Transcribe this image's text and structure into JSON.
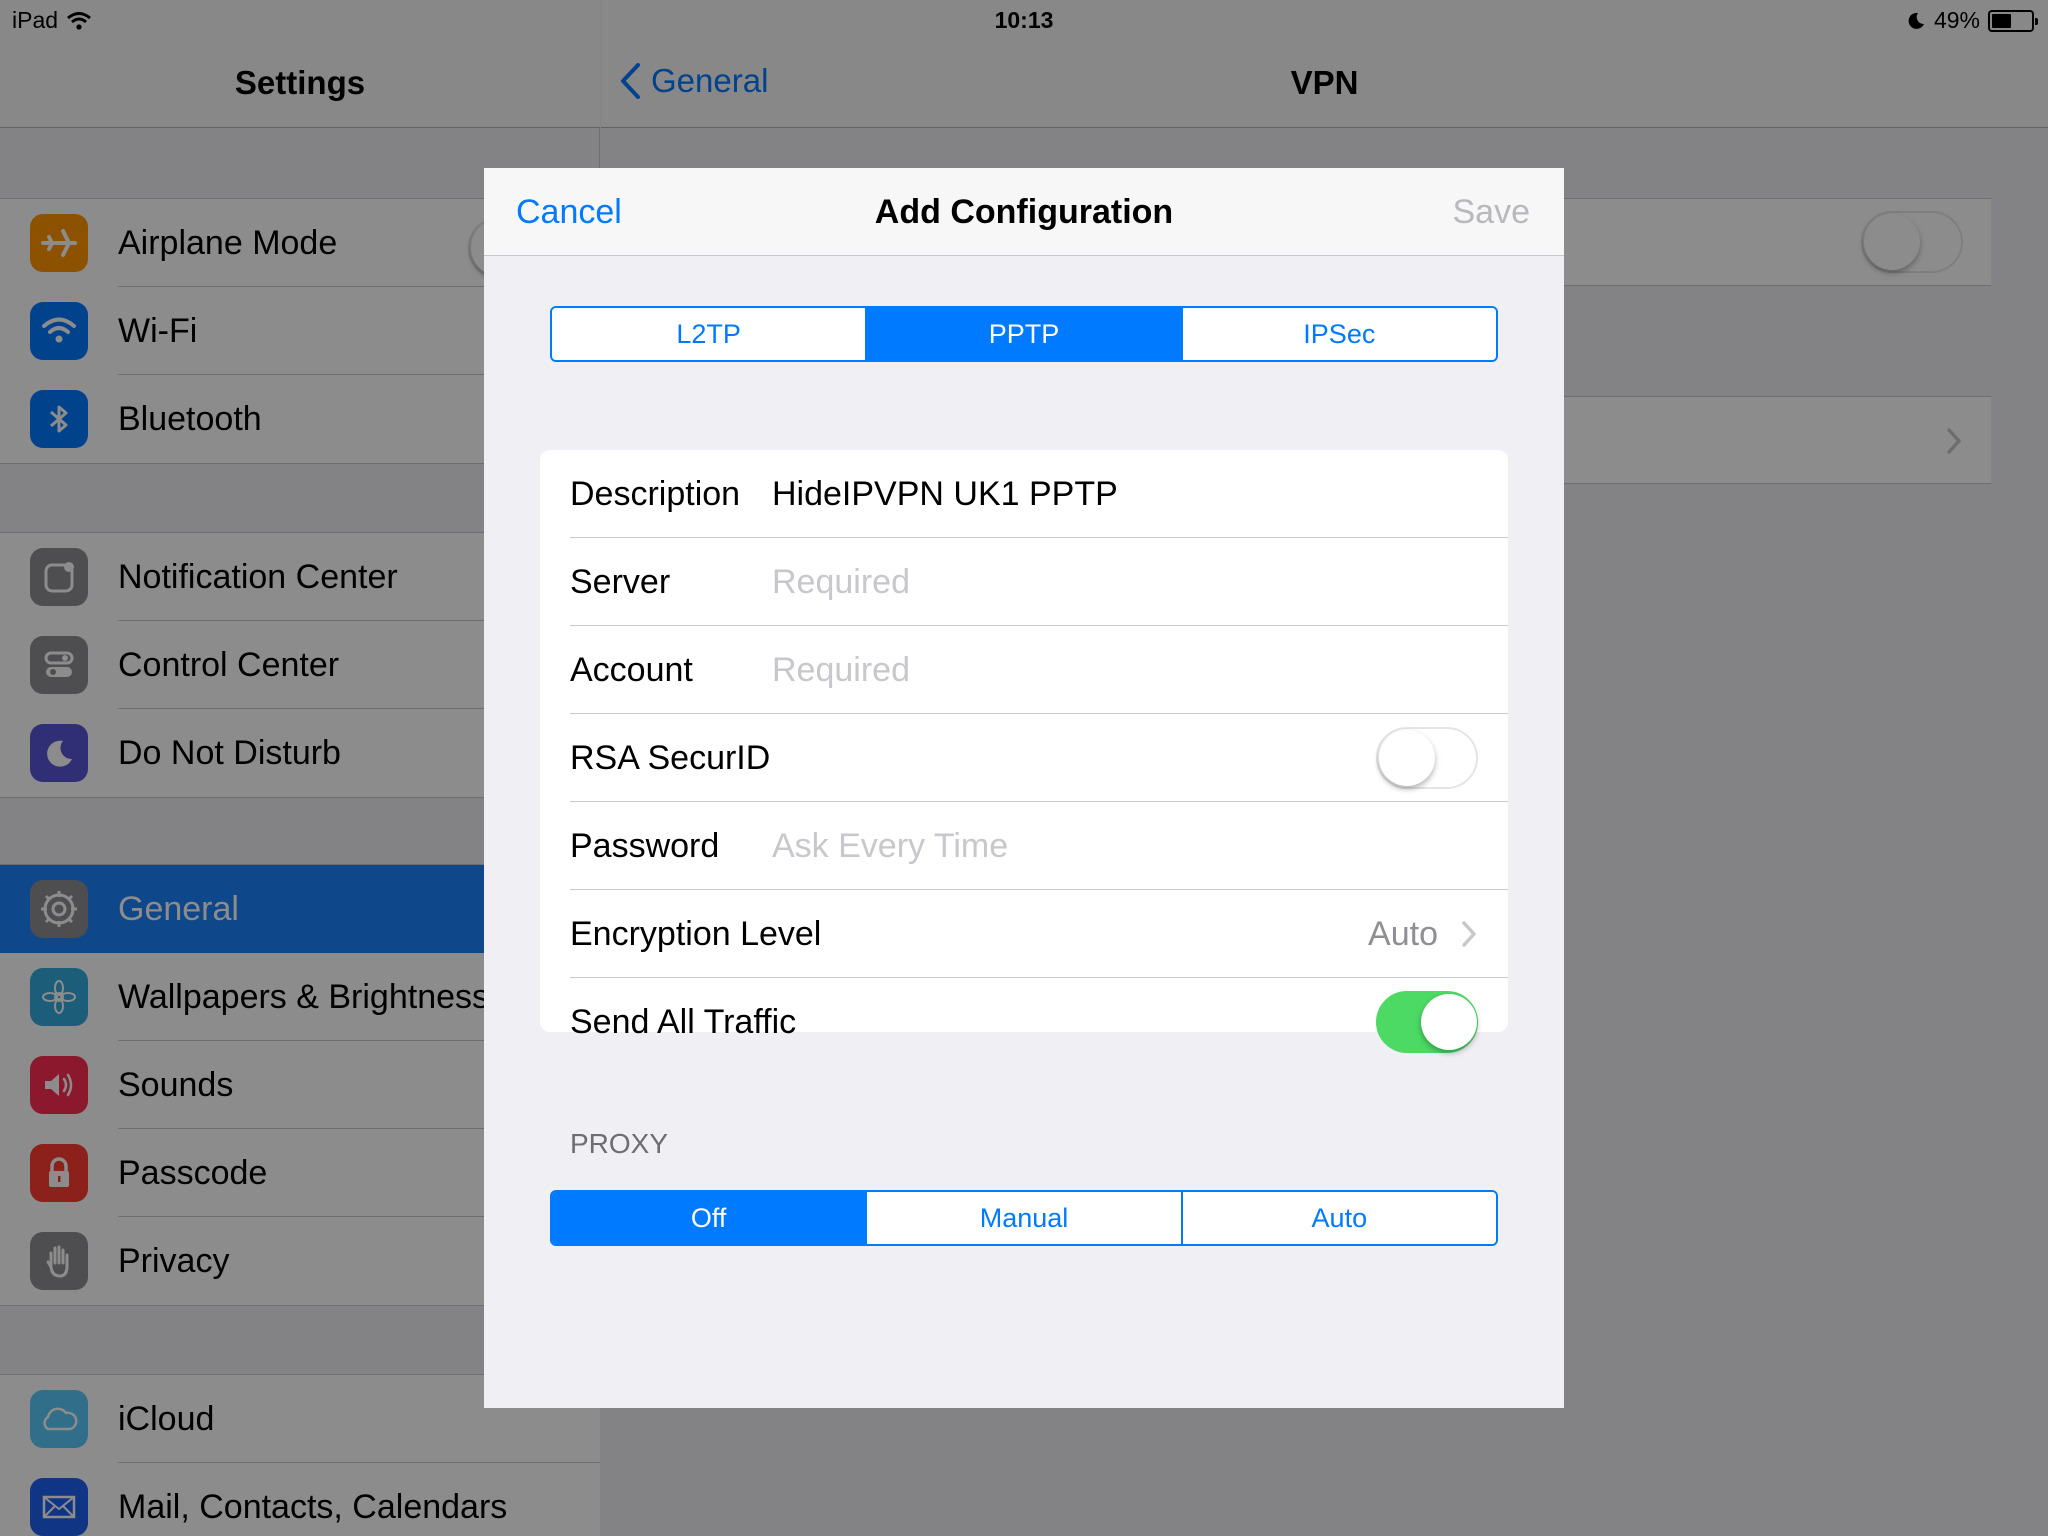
{
  "status_bar": {
    "device": "iPad",
    "time": "10:13",
    "battery": "49%",
    "battery_level": 0.49
  },
  "master": {
    "title": "Settings",
    "groups": [
      [
        {
          "label": "Airplane Mode",
          "icon": "airplane-icon",
          "color": "#ff9500"
        },
        {
          "label": "Wi-Fi",
          "icon": "wifi-icon",
          "color": "#007aff"
        },
        {
          "label": "Bluetooth",
          "icon": "bluetooth-icon",
          "color": "#007aff"
        }
      ],
      [
        {
          "label": "Notification Center",
          "icon": "notification-center-icon",
          "color": "#8e8e93"
        },
        {
          "label": "Control Center",
          "icon": "control-center-icon",
          "color": "#8e8e93"
        },
        {
          "label": "Do Not Disturb",
          "icon": "moon-icon",
          "color": "#5856d6"
        }
      ],
      [
        {
          "label": "General",
          "icon": "gear-icon",
          "color": "#8e8e93",
          "selected": true
        },
        {
          "label": "Wallpapers & Brightness",
          "icon": "wallpaper-flower-icon",
          "color": "#34aadc"
        },
        {
          "label": "Sounds",
          "icon": "speaker-icon",
          "color": "#ff2d55"
        },
        {
          "label": "Passcode",
          "icon": "lock-icon",
          "color": "#ff3b30"
        },
        {
          "label": "Privacy",
          "icon": "hand-icon",
          "color": "#8e8e93"
        }
      ],
      [
        {
          "label": "iCloud",
          "icon": "cloud-icon",
          "color": "#5ac8fa"
        },
        {
          "label": "Mail, Contacts, Calendars",
          "icon": "mail-icon",
          "color": "#1d62f0"
        }
      ]
    ]
  },
  "detail": {
    "back_label": "General",
    "title": "VPN"
  },
  "modal": {
    "cancel_label": "Cancel",
    "title": "Add Configuration",
    "save_label": "Save",
    "type_segments": [
      {
        "label": "L2TP",
        "active": false
      },
      {
        "label": "PPTP",
        "active": true
      },
      {
        "label": "IPSec",
        "active": false
      }
    ],
    "fields": {
      "description": {
        "label": "Description",
        "value": "HideIPVPN UK1 PPTP"
      },
      "server": {
        "label": "Server",
        "placeholder": "Required"
      },
      "account": {
        "label": "Account",
        "placeholder": "Required"
      },
      "rsa": {
        "label": "RSA SecurID",
        "on": false
      },
      "password": {
        "label": "Password",
        "placeholder": "Ask Every Time"
      },
      "encryption": {
        "label": "Encryption Level",
        "value": "Auto"
      },
      "send_all": {
        "label": "Send All Traffic",
        "on": true
      }
    },
    "proxy": {
      "header": "PROXY",
      "segments": [
        {
          "label": "Off",
          "active": true
        },
        {
          "label": "Manual",
          "active": false
        },
        {
          "label": "Auto",
          "active": false
        }
      ]
    }
  },
  "colors": {
    "accent": "#007aff",
    "toggle_on": "#4cd964",
    "selected_row": "#1a82fb"
  }
}
